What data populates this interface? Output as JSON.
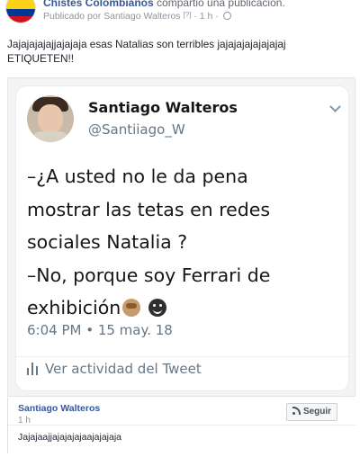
{
  "post": {
    "page_name": "Chistes Colombianos",
    "shared_text": " compartió una publicación.",
    "published_by": "Publicado por Santiago Walteros",
    "published_by_marker": "[?]",
    "time": "· 1 h ·",
    "text_line1": "Jajajajajajjajajaja esas Natalias son terribles jajajajajajajajaj",
    "text_line2": "ETIQUETEN!!"
  },
  "tweet": {
    "name": "Santiago Walteros",
    "handle": "@Santiiago_W",
    "lines": [
      "–¿A usted no le da pena",
      "mostrar las tetas en redes",
      "sociales Natalia ?",
      "–No, porque soy Ferrari de",
      "exhibición"
    ],
    "emojis": [
      "see-no-evil-monkey-icon",
      "grinning-face-icon"
    ],
    "timestamp": "6:04 PM • 15 may. 18",
    "activity": "Ver actividad del Tweet"
  },
  "comment": {
    "author": "Santiago Walteros",
    "time": "1 h",
    "text": "Jajajaajjajajajajaajajajaja",
    "follow_label": "Seguir"
  },
  "colors": {
    "link_blue": "#365899",
    "meta_gray": "#90949c",
    "twitter_gray": "#657786"
  }
}
